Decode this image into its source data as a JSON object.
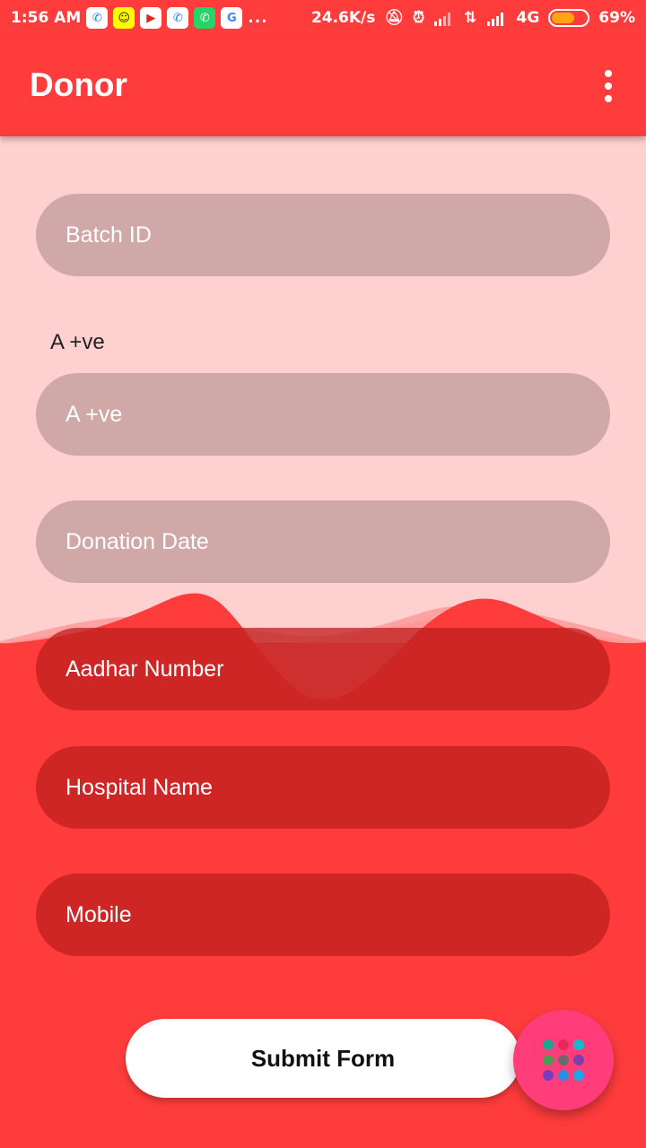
{
  "status_bar": {
    "time": "1:56 AM",
    "more": "...",
    "speed": "24.6K/s",
    "network": "4G",
    "battery": "69%",
    "battery_level": 0.69,
    "notification_icons": [
      "phone-icon",
      "snapchat-icon",
      "youtube-icon",
      "phone-icon",
      "whatsapp-icon",
      "google-icon"
    ],
    "system_icons": [
      "silent-icon",
      "alarm-icon",
      "signal-icon",
      "data-arrows-icon",
      "signal-icon"
    ]
  },
  "app_bar": {
    "title": "Donor",
    "menu_icon": "more-vert-icon"
  },
  "form": {
    "batch_id_placeholder": "Batch ID",
    "blood_group_label": "A +ve",
    "blood_group_value": "A +ve",
    "donation_date_placeholder": "Donation Date",
    "aadhar_placeholder": "Aadhar Number",
    "hospital_placeholder": "Hospital Name",
    "mobile_placeholder": "Mobile"
  },
  "submit": {
    "label": "Submit Form"
  },
  "fab": {
    "icon": "apps-grid-icon",
    "dot_colors": [
      "#1fa58e",
      "#e8265a",
      "#18b9c9",
      "#4f9a4d",
      "#6b6b6b",
      "#7c3fb0",
      "#7a3bbf",
      "#2b8de0",
      "#1aa9e8"
    ]
  },
  "colors": {
    "primary": "#ff3c3c",
    "content_bg": "#ffd0d0",
    "fab": "#ff3d7a"
  }
}
